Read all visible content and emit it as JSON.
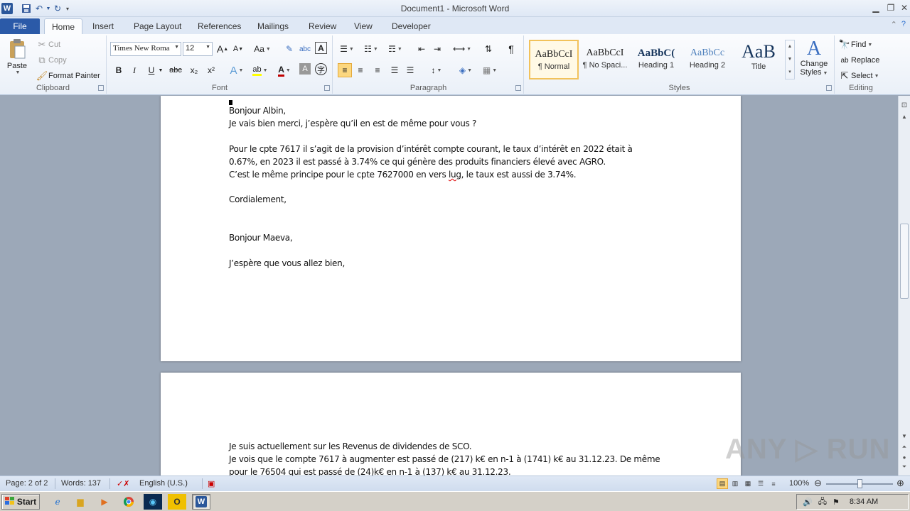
{
  "window": {
    "title": "Document1 - Microsoft Word",
    "app_icon_letter": "W"
  },
  "tabs": [
    "File",
    "Home",
    "Insert",
    "Page Layout",
    "References",
    "Mailings",
    "Review",
    "View",
    "Developer"
  ],
  "active_tab": "Home",
  "clipboard": {
    "paste": "Paste",
    "cut": "Cut",
    "copy": "Copy",
    "format_painter": "Format Painter",
    "label": "Clipboard"
  },
  "font": {
    "name": "Times New Roma",
    "size": "12",
    "label": "Font",
    "bold": "B",
    "italic": "I",
    "underline": "U",
    "strike": "abc",
    "subscript": "x₂",
    "superscript": "x²",
    "grow": "A",
    "shrink": "A",
    "case": "Aa"
  },
  "paragraph": {
    "label": "Paragraph",
    "pilcrow": "¶"
  },
  "styles": {
    "label": "Styles",
    "items": [
      {
        "sample": "AaBbCcI",
        "name": "¶ Normal"
      },
      {
        "sample": "AaBbCcI",
        "name": "¶ No Spaci..."
      },
      {
        "sample": "AaBbC(",
        "name": "Heading 1"
      },
      {
        "sample": "AaBbCc",
        "name": "Heading 2"
      },
      {
        "sample": "AaB",
        "name": "Title"
      }
    ],
    "change_styles": "Change Styles",
    "change_styles_line1": "Change",
    "change_styles_line2": "Styles"
  },
  "editing": {
    "label": "Editing",
    "find": "Find",
    "replace": "Replace",
    "select": "Select"
  },
  "document": {
    "page1_lines": [
      "Bonjour Albin,",
      "Je vais bien merci, j’espère qu’il en est de même pour vous ?",
      "Pour le cpte 7617  il s’agit de la provision d’intérêt compte courant, le taux d’intérêt en 2022 était à",
      "0.67%, en 2023  il est passé à 3.74% ce qui génère des produits financiers élevé avec AGRO.",
      "C’est le même principe pour le cpte 7627000  en vers ",
      "lug",
      ", le taux est aussi de 3.74%.",
      "Cordialement,",
      "Bonjour Maeva,",
      "J’espère que vous allez bien,"
    ],
    "page2_lines": [
      "Je suis actuellement sur les Revenus de dividendes de SCO.",
      "Je vois que le compte 7617  à augmenter est passé de (217) k€ en n-1 à (1741) k€ au 31.12.23.  De même",
      "pour le 76504 qui est passé de (24)k€ en n-1 à (137) k€ au 31.12.23."
    ]
  },
  "watermark": "ANY ▷ RUN",
  "status": {
    "page": "Page: 2 of 2",
    "words": "Words: 137",
    "language": "English (U.S.)",
    "zoom": "100%"
  },
  "taskbar": {
    "start": "Start",
    "clock": "8:34 AM"
  }
}
